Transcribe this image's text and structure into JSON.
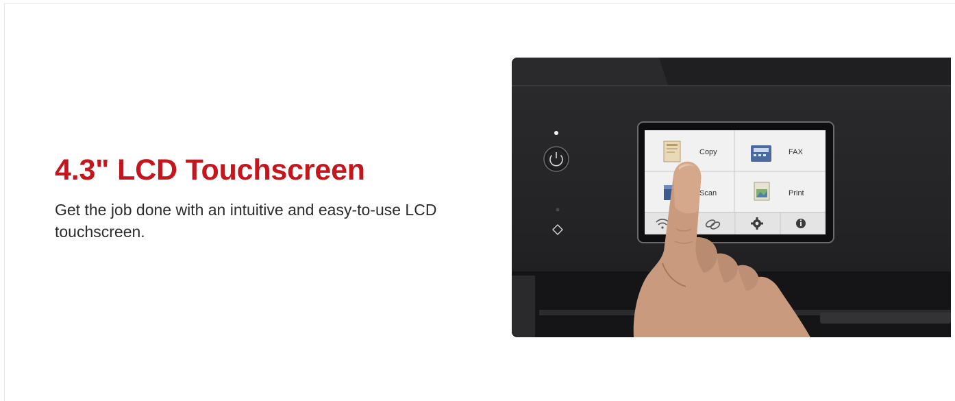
{
  "feature": {
    "headline": "4.3\" LCD Touchscreen",
    "description": "Get the job done with an intuitive and easy-to-use LCD touchscreen."
  },
  "lcd": {
    "tiles": [
      {
        "label": "Copy",
        "icon": "copy-icon"
      },
      {
        "label": "FAX",
        "icon": "fax-icon"
      },
      {
        "label": "Scan",
        "icon": "scan-icon"
      },
      {
        "label": "Print",
        "icon": "print-icon"
      }
    ],
    "bottom_bar_icons": [
      "wifi-icon",
      "link-icon",
      "gear-icon",
      "info-icon"
    ]
  },
  "colors": {
    "accent": "#c4161c",
    "printer_body": "#262628",
    "screen_bg": "#f1f1f1"
  }
}
